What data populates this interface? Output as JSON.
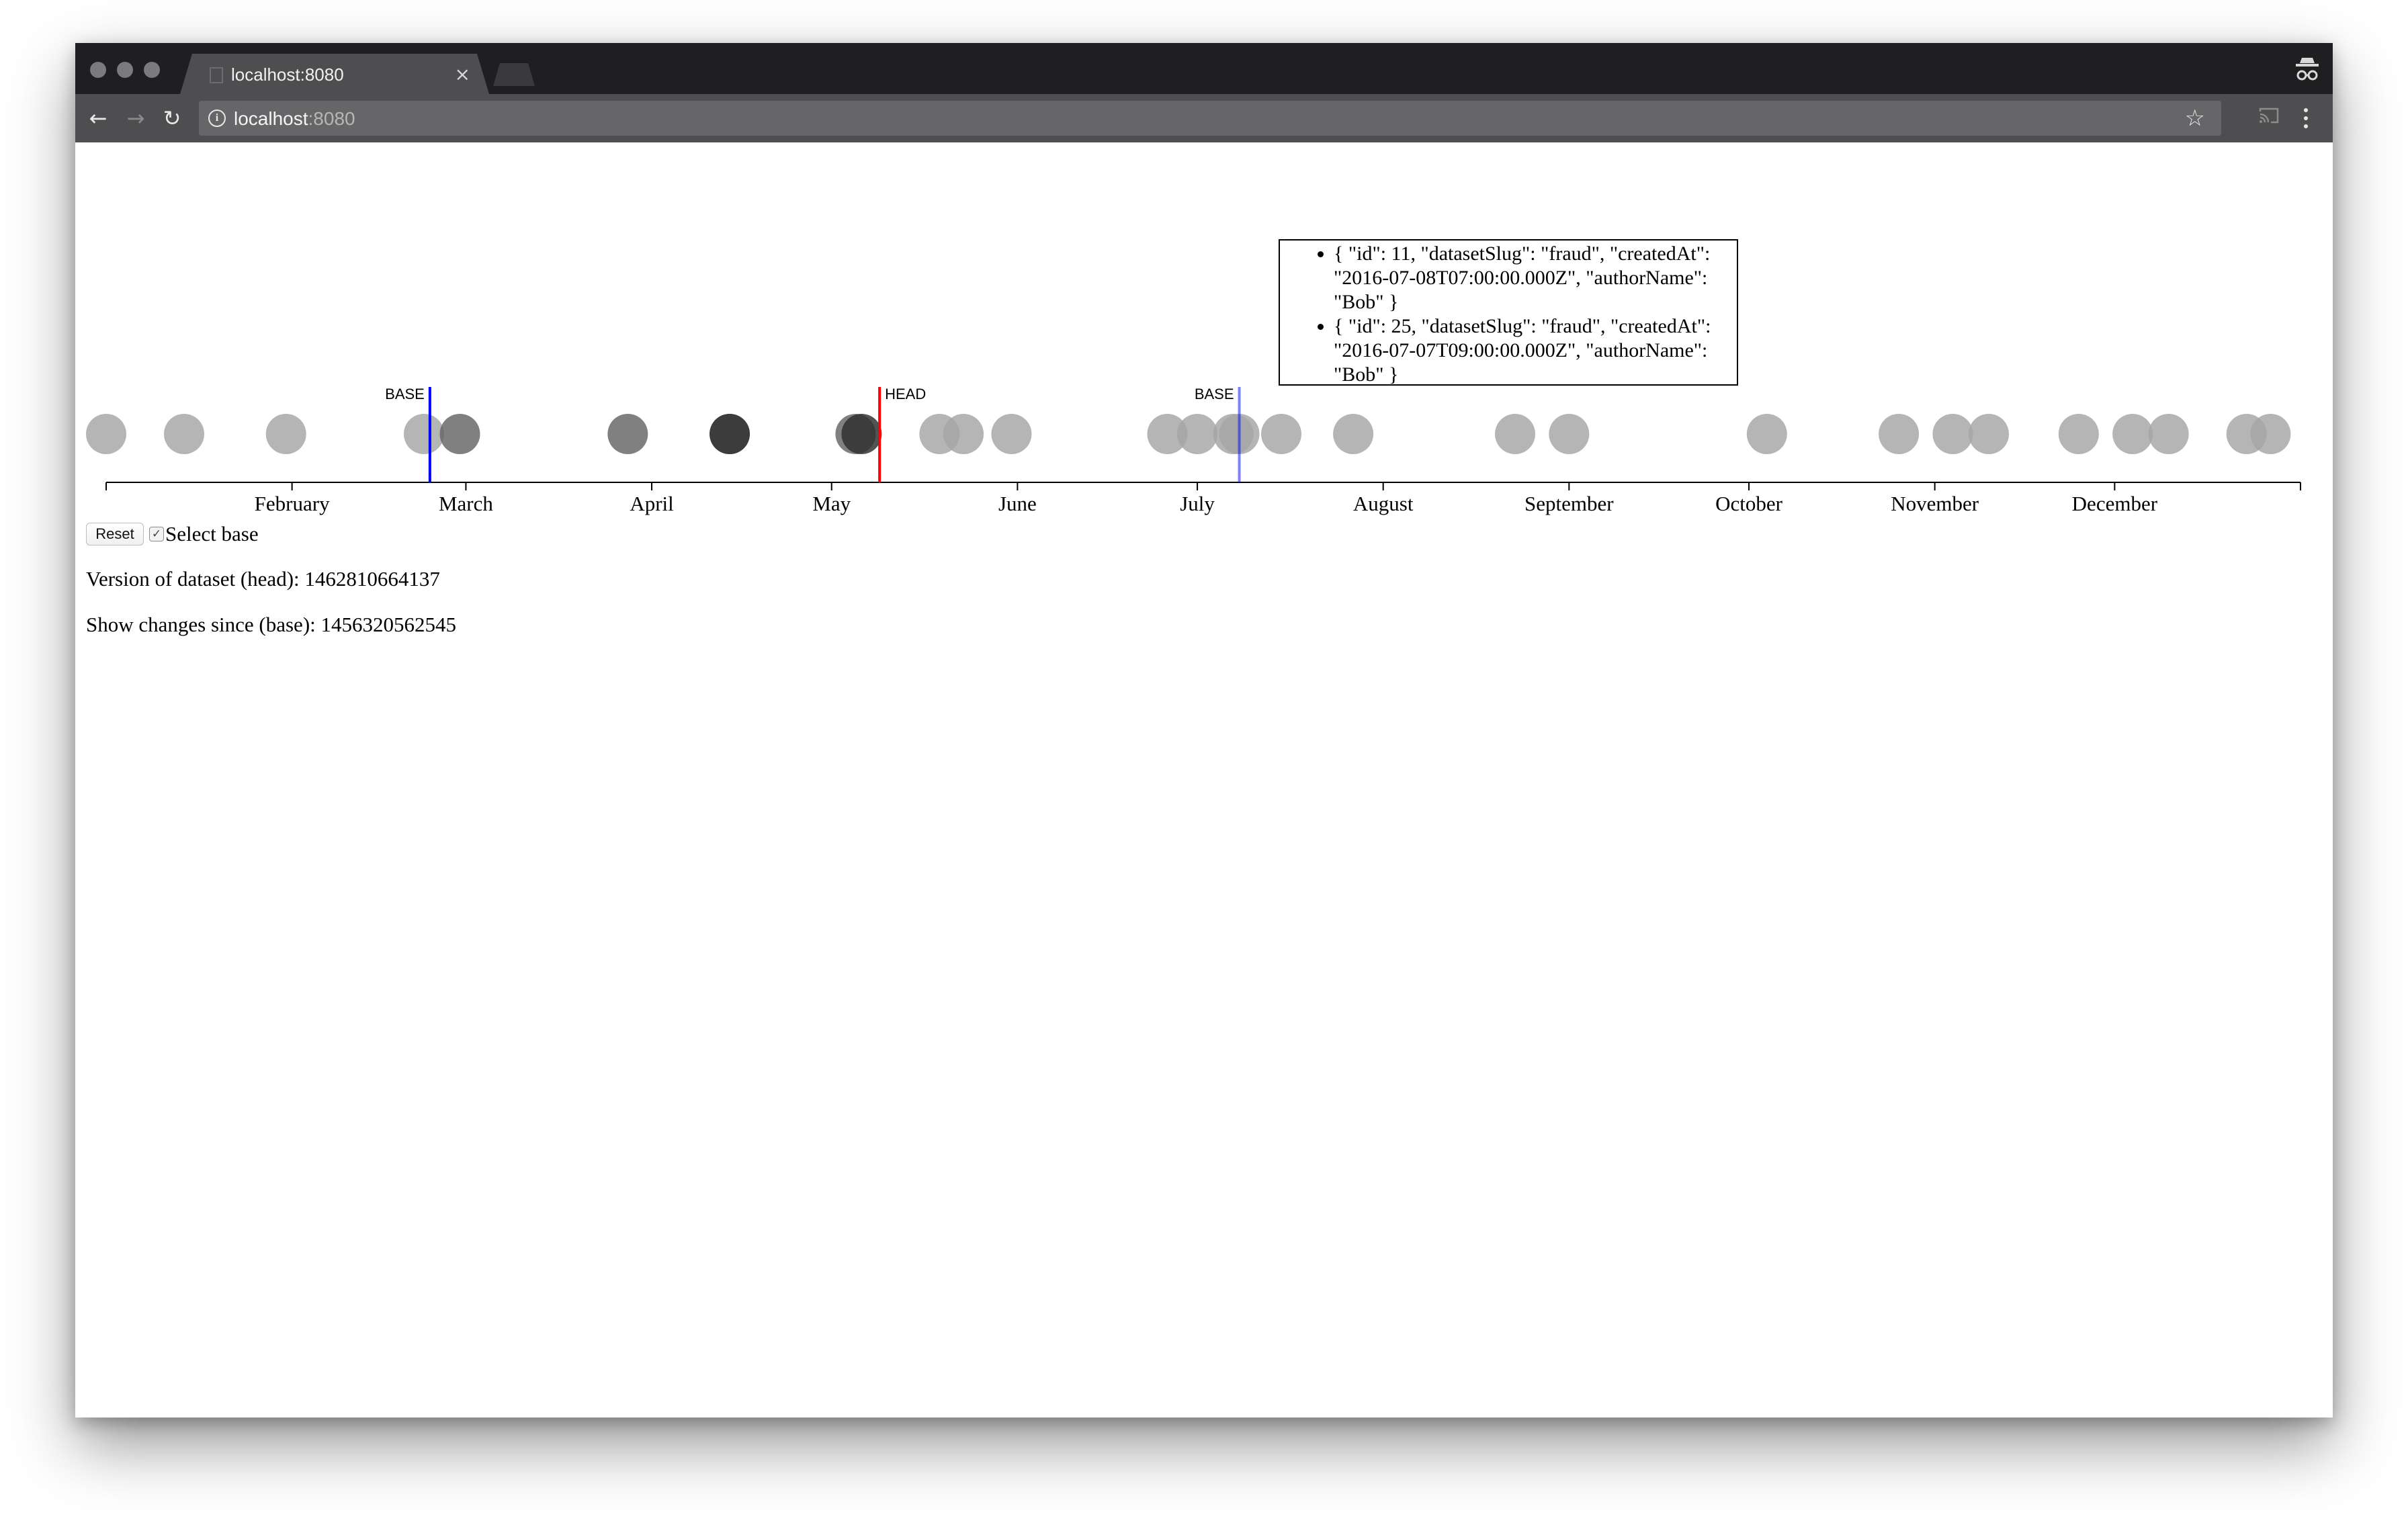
{
  "browser": {
    "tab_title": "localhost:8080",
    "tab_close": "×",
    "url_host": "localhost",
    "url_port": ":8080",
    "icons": [
      "back-arrow-icon",
      "forward-arrow-icon",
      "reload-icon",
      "info-icon",
      "star-icon",
      "cast-icon",
      "menu-icon",
      "incognito-icon"
    ]
  },
  "timeline": {
    "months": [
      "February",
      "March",
      "April",
      "May",
      "June",
      "July",
      "August",
      "September",
      "October",
      "November",
      "December"
    ],
    "markers": [
      {
        "label": "BASE",
        "date": "2016-02-24",
        "color": "#0000ff",
        "opacity": 1
      },
      {
        "label": "HEAD",
        "date": "2016-05-09",
        "color": "#ff0000",
        "opacity": 1
      },
      {
        "label": "BASE",
        "date": "2016-07-08",
        "color": "#0000ff",
        "opacity": 0.5
      }
    ],
    "dataset_versions": [
      {
        "date": "2016-01-01",
        "shade": "#a5a5a5"
      },
      {
        "date": "2016-01-14",
        "shade": "#a5a5a5"
      },
      {
        "date": "2016-01-31",
        "shade": "#a5a5a5"
      },
      {
        "date": "2016-02-23",
        "shade": "#a5a5a5"
      },
      {
        "date": "2016-02-29",
        "shade": "#646464"
      },
      {
        "date": "2016-03-28",
        "shade": "#646464"
      },
      {
        "date": "2016-04-14",
        "shade": "#646464"
      },
      {
        "date": "2016-04-14",
        "shade": "#2d2d2d"
      },
      {
        "date": "2016-05-05",
        "shade": "#646464"
      },
      {
        "date": "2016-05-06",
        "shade": "#2d2d2d"
      },
      {
        "date": "2016-05-19",
        "shade": "#a5a5a5"
      },
      {
        "date": "2016-05-23",
        "shade": "#a5a5a5"
      },
      {
        "date": "2016-05-31",
        "shade": "#a5a5a5"
      },
      {
        "date": "2016-06-26",
        "shade": "#a5a5a5"
      },
      {
        "date": "2016-07-01",
        "shade": "#a5a5a5"
      },
      {
        "date": "2016-07-07",
        "shade": "#a5a5a5"
      },
      {
        "date": "2016-07-08",
        "shade": "#a5a5a5"
      },
      {
        "date": "2016-07-15",
        "shade": "#a5a5a5"
      },
      {
        "date": "2016-07-27",
        "shade": "#a5a5a5"
      },
      {
        "date": "2016-08-23",
        "shade": "#a5a5a5"
      },
      {
        "date": "2016-09-01",
        "shade": "#a5a5a5"
      },
      {
        "date": "2016-10-04",
        "shade": "#a5a5a5"
      },
      {
        "date": "2016-10-26",
        "shade": "#a5a5a5"
      },
      {
        "date": "2016-11-04",
        "shade": "#a5a5a5"
      },
      {
        "date": "2016-11-10",
        "shade": "#a5a5a5"
      },
      {
        "date": "2016-11-25",
        "shade": "#a5a5a5"
      },
      {
        "date": "2016-12-04",
        "shade": "#a5a5a5"
      },
      {
        "date": "2016-12-10",
        "shade": "#a5a5a5"
      },
      {
        "date": "2016-12-23",
        "shade": "#a5a5a5"
      },
      {
        "date": "2016-12-27",
        "shade": "#a5a5a5"
      }
    ]
  },
  "tooltip": {
    "items": [
      "{ \"id\": 11, \"datasetSlug\": \"fraud\", \"createdAt\": \"2016-07-08T07:00:00.000Z\", \"authorName\": \"Bob\" }",
      "{ \"id\": 25, \"datasetSlug\": \"fraud\", \"createdAt\": \"2016-07-07T09:00:00.000Z\", \"authorName\": \"Bob\" }"
    ]
  },
  "controls": {
    "reset_label": "Reset",
    "select_base_label": "Select base",
    "select_base_checked": true
  },
  "info": {
    "head_text": "Version of dataset (head): 1462810664137",
    "base_text": "Show changes since (base): 1456320562545"
  }
}
